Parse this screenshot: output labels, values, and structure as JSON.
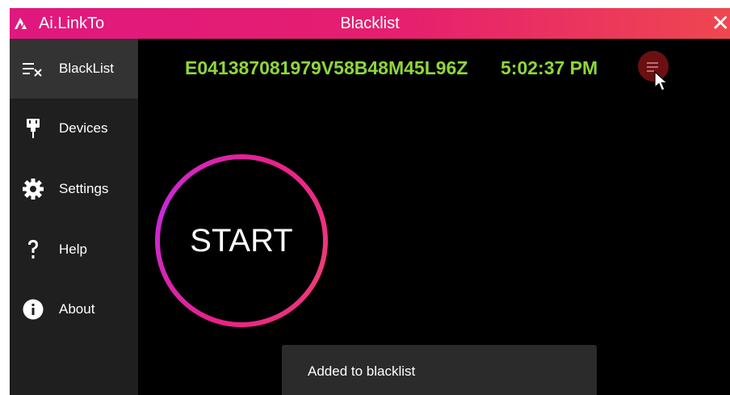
{
  "window": {
    "app_name": "Ai.LinkTo",
    "title": "Blacklist",
    "close_glyph": "✕",
    "accent_start": "#e0187f",
    "accent_end": "#ef4750"
  },
  "sidebar": {
    "items": [
      {
        "label": "BlackList",
        "icon": "blacklist-icon",
        "active": true
      },
      {
        "label": "Devices",
        "icon": "usb-plug-icon"
      },
      {
        "label": "Settings",
        "icon": "gear-icon"
      },
      {
        "label": "Help",
        "icon": "question-mark-icon"
      },
      {
        "label": "About",
        "icon": "info-icon"
      }
    ]
  },
  "header": {
    "code": "E041387081979V58B48M45L96Z",
    "time": "5:02:37 PM",
    "text_color": "#8fd63c"
  },
  "main": {
    "start_label": "START"
  },
  "toast": {
    "message": "Added to blacklist"
  }
}
